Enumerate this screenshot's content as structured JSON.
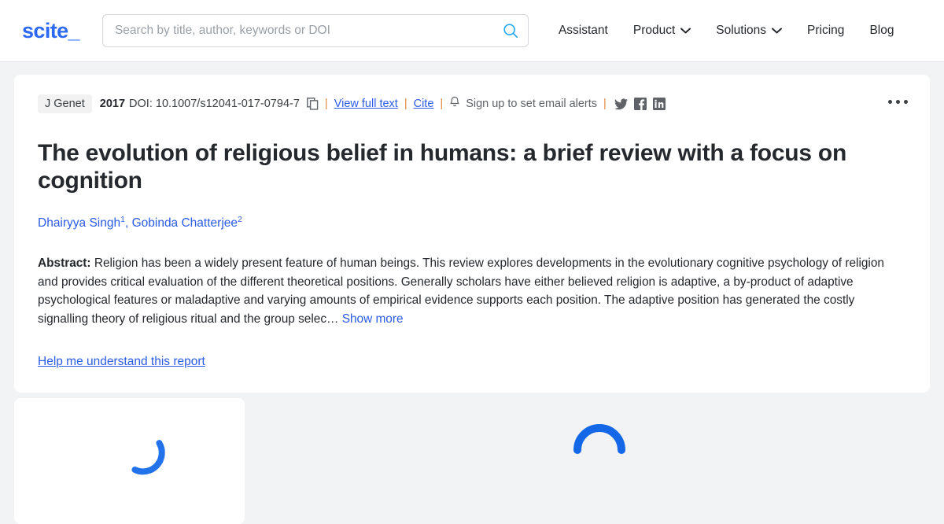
{
  "header": {
    "logo": "scite_",
    "search": {
      "placeholder": "Search by title, author, keywords or DOI",
      "value": "",
      "icon": "search-icon"
    },
    "nav": [
      {
        "label": "Assistant",
        "caret": false
      },
      {
        "label": "Product",
        "caret": true
      },
      {
        "label": "Solutions",
        "caret": true
      },
      {
        "label": "Pricing",
        "caret": false
      },
      {
        "label": "Blog",
        "caret": false
      }
    ]
  },
  "paper": {
    "journal": "J Genet",
    "year": "2017",
    "doi_label": "DOI: 10.1007/s12041-017-0794-7",
    "copy_icon": "copy-icon",
    "separator": "|",
    "view_full_text": "View full text",
    "cite": "Cite",
    "alerts_icon": "bell-icon",
    "alerts_label": "Sign up to set email alerts",
    "socials": [
      {
        "name": "twitter-icon",
        "label": "Twitter"
      },
      {
        "name": "facebook-icon",
        "label": "Facebook"
      },
      {
        "name": "linkedin-icon",
        "label": "LinkedIn"
      }
    ],
    "more_menu": "more-options-icon",
    "title": "The evolution of religious belief in humans: a brief review with a focus on cognition",
    "authors": [
      {
        "name": "Dhairyya Singh",
        "affiliation": "1"
      },
      {
        "name": "Gobinda Chatterjee",
        "affiliation": "2"
      }
    ],
    "authors_separator": ", ",
    "abstract_label": "Abstract:",
    "abstract_text": "Religion has been a widely present feature of human beings. This review explores developments in the evolutionary cognitive psychology of religion and provides critical evaluation of the different theoretical positions. Generally scholars have either believed religion is adaptive, a by-product of adaptive psychological features or maladaptive and varying amounts of empirical evidence supports each position. The adaptive position has generated the costly signalling theory of religious ritual and the group selec…",
    "show_more": "Show more",
    "help_link": "Help me understand this report"
  },
  "loading": {
    "spinner_left": "loading-spinner",
    "spinner_right": "loading-spinner"
  },
  "colors": {
    "brand_blue": "#2b69f5",
    "link_blue": "#2b5ce6",
    "search_icon_blue": "#23a9ef",
    "spinner_blue": "#2272ec",
    "page_bg": "#f2f3f4",
    "text": "#25282c",
    "muted": "#5f6368",
    "separator_orange": "#e08a3c"
  }
}
